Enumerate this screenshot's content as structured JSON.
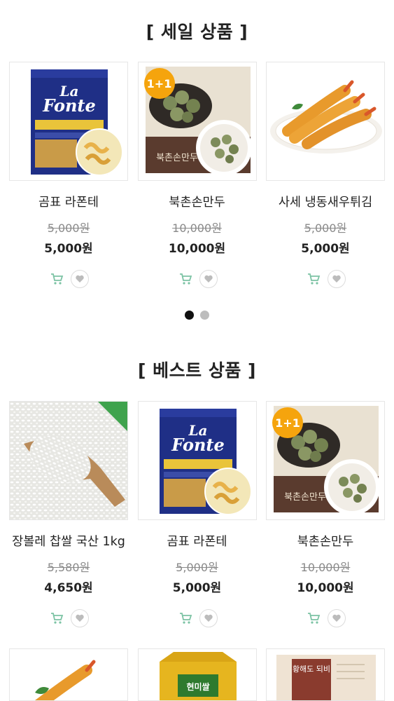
{
  "sale_section": {
    "title": "[ 세일 상품 ]",
    "products": [
      {
        "name": "곰표 라폰테",
        "old_price": "5,000원",
        "price": "5,000원",
        "image": "pasta-package"
      },
      {
        "name": "북촌손만두",
        "old_price": "10,000원",
        "price": "10,000원",
        "image": "dumpling-package",
        "badge": "1+1"
      },
      {
        "name": "사세 냉동새우튀김",
        "old_price": "5,000원",
        "price": "5,000원",
        "image": "fried-shrimp"
      }
    ],
    "pagination": {
      "count": 2,
      "active": 1
    }
  },
  "best_section": {
    "title": "[ 베스트 상품 ]",
    "products": [
      {
        "name": "장볼레 찹쌀 국산 1kg",
        "old_price": "5,580원",
        "price": "4,650원",
        "image": "glutinous-rice"
      },
      {
        "name": "곰표 라폰테",
        "old_price": "5,000원",
        "price": "5,000원",
        "image": "pasta-package"
      },
      {
        "name": "북촌손만두",
        "old_price": "10,000원",
        "price": "10,000원",
        "image": "dumpling-package",
        "badge": "1+1"
      }
    ]
  },
  "packaging_text": {
    "pasta_brand_line1": "La",
    "pasta_brand_line2": "Fonte",
    "dumpling_label": "북촌손만두",
    "rice_bag_label": "현미쌀",
    "book_text": "황해도 되비"
  },
  "colors": {
    "badge": "#f5a40d",
    "icon_green": "#7cc3a4",
    "dot_active": "#111111",
    "dot_inactive": "#bdbdbd"
  }
}
